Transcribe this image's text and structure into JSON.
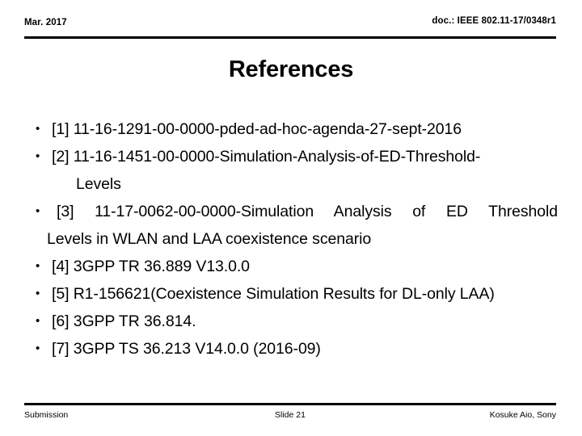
{
  "header": {
    "date": "Mar. 2017",
    "doc": "doc.: IEEE 802.11-17/0348r1"
  },
  "title": "References",
  "references": {
    "bullet_glyph": "•",
    "items": [
      {
        "line1": "[1] 11-16-1291-00-0000-pded-ad-hoc-agenda-27-sept-2016"
      },
      {
        "line1": "[2] 11-16-1451-00-0000-Simulation-Analysis-of-ED-Threshold-",
        "line2": "Levels"
      },
      {
        "line1": "[3] 11-17-0062-00-0000-Simulation Analysis of ED Threshold",
        "line2": "Levels in WLAN and LAA coexistence scenario"
      },
      {
        "line1": "[4] 3GPP TR 36.889 V13.0.0"
      },
      {
        "line1": "[5] R1-156621(Coexistence Simulation Results for DL-only LAA)"
      },
      {
        "line1": "[6] 3GPP TR 36.814."
      },
      {
        "line1": "[7] 3GPP TS 36.213 V14.0.0 (2016-09)"
      }
    ]
  },
  "footer": {
    "left": "Submission",
    "center": "Slide 21",
    "right": "Kosuke Aio, Sony"
  }
}
